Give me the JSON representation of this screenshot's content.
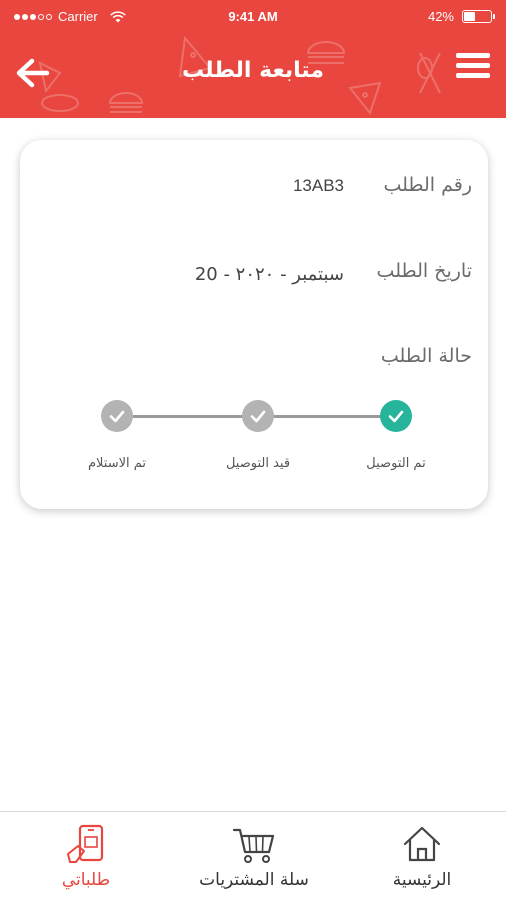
{
  "status_bar": {
    "carrier": "Carrier",
    "time": "9:41 AM",
    "battery": "42%",
    "battery_level": 0.42
  },
  "header": {
    "title": "متابعة الطلب",
    "back_icon": "arrow-left-icon",
    "menu_icon": "hamburger-menu-icon"
  },
  "order": {
    "number_label": "رقم الطلب",
    "number_value": "13AB3",
    "date_label": "تاريخ الطلب",
    "date_value": "سبتمبر - ٢٠٢٠ - 20",
    "status_label": "حالة الطلب",
    "steps": [
      {
        "label": "تم التوصيل",
        "done": true
      },
      {
        "label": "قيد التوصيل",
        "done": false
      },
      {
        "label": "تم الاستلام",
        "done": false
      }
    ]
  },
  "bottom_nav": {
    "items": [
      {
        "label": "الرئيسية",
        "icon": "home-icon",
        "active": false
      },
      {
        "label": "سلة المشتريات",
        "icon": "cart-icon",
        "active": false
      },
      {
        "label": "طلباتي",
        "icon": "my-orders-icon",
        "active": true
      }
    ]
  },
  "colors": {
    "primary": "#e8463f",
    "success": "#26b59a",
    "inactive": "#b3b3b3"
  }
}
